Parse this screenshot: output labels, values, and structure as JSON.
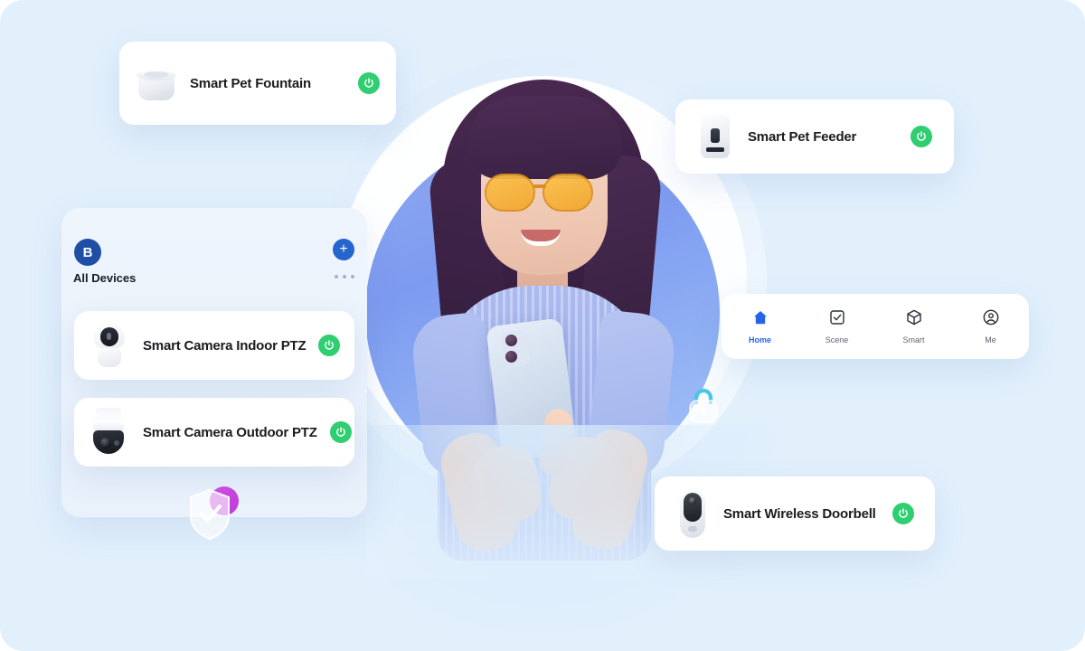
{
  "canvas": {
    "background_color": "#e2f0fc",
    "accent_blue": "#2563eb",
    "brand_navy": "#1f4fa5",
    "toggle_green": "#2ece71",
    "circle_gradient_from": "#8ea8f0",
    "circle_gradient_to": "#a9c4f7",
    "accent_magenta": "#c843dd"
  },
  "floating_cards": {
    "pet_fountain": {
      "label": "Smart Pet Fountain",
      "icon": "pet-fountain",
      "power_state": "on"
    },
    "pet_feeder": {
      "label": "Smart Pet Feeder",
      "icon": "pet-feeder",
      "power_state": "on"
    },
    "wireless_doorbell": {
      "label": "Smart Wireless Doorbell",
      "icon": "doorbell",
      "power_state": "on"
    }
  },
  "panel": {
    "logo_text": "B",
    "logo_icon": "brand-logo-icon",
    "add_icon": "plus-icon",
    "add_label": "+",
    "title": "All Devices",
    "more_icon": "ellipsis-icon",
    "devices": [
      {
        "label": "Smart Camera Indoor PTZ",
        "icon": "indoor-camera",
        "power_state": "on"
      },
      {
        "label": "Smart Camera Outdoor PTZ",
        "icon": "outdoor-camera",
        "power_state": "on"
      }
    ]
  },
  "navbar": {
    "items": [
      {
        "label": "Home",
        "icon": "home-icon",
        "active": true
      },
      {
        "label": "Scene",
        "icon": "scene-checkbox-icon",
        "active": false
      },
      {
        "label": "Smart",
        "icon": "cube-icon",
        "active": false
      },
      {
        "label": "Me",
        "icon": "profile-icon",
        "active": false
      }
    ]
  },
  "decorations": {
    "lock_badge_icon": "lock-icon",
    "shield_badge_icon": "shield-check-icon"
  },
  "hero": {
    "description": "woman-with-smartphone-photo"
  }
}
